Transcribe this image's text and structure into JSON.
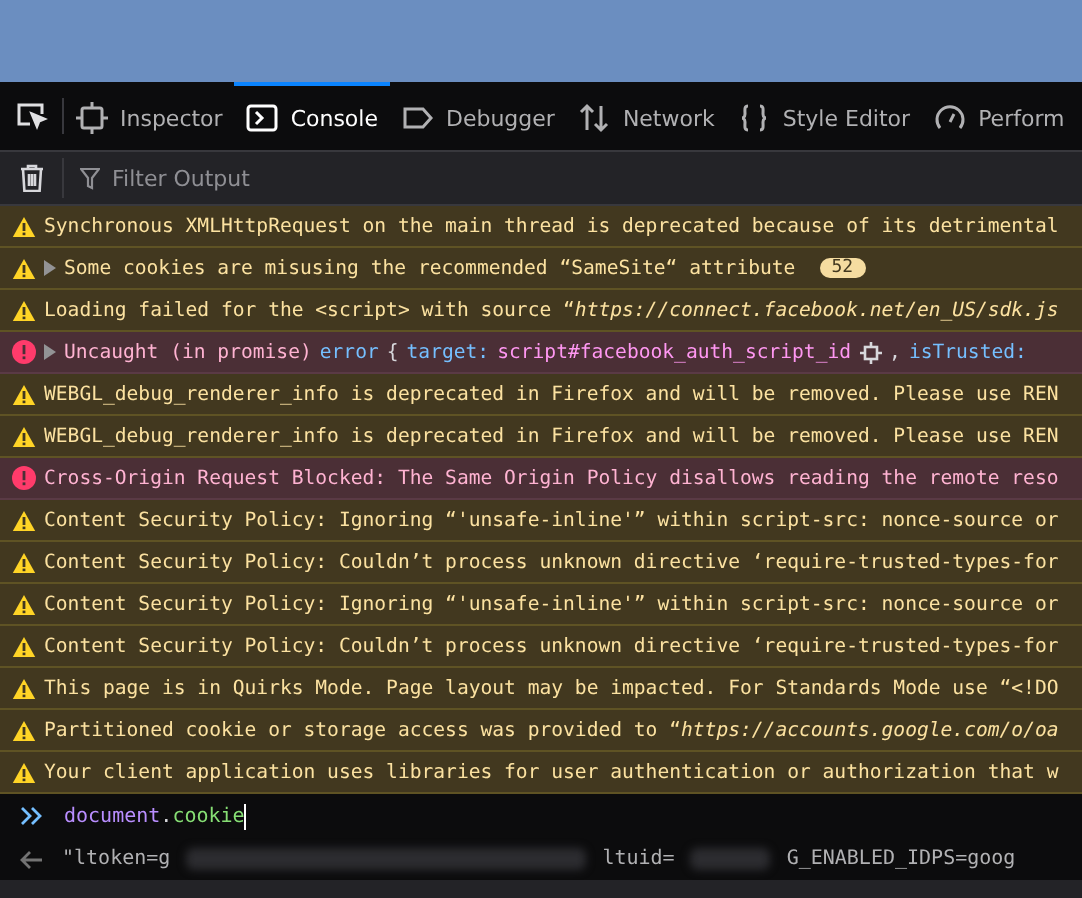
{
  "tabs": [
    {
      "label": "Inspector",
      "selected": false
    },
    {
      "label": "Console",
      "selected": true
    },
    {
      "label": "Debugger",
      "selected": false
    },
    {
      "label": "Network",
      "selected": false
    },
    {
      "label": "Style Editor",
      "selected": false
    },
    {
      "label": "Perform",
      "selected": false
    }
  ],
  "filter": {
    "placeholder": "Filter Output"
  },
  "messages": [
    {
      "kind": "warning",
      "expandable": false,
      "text": "Synchronous XMLHttpRequest on the main thread is deprecated because of its detrimental"
    },
    {
      "kind": "warning",
      "expandable": true,
      "text": "Some cookies are misusing the recommended “SameSite“ attribute",
      "badge": "52"
    },
    {
      "kind": "warning",
      "expandable": false,
      "text": "Loading failed for the <script> with source “*https://connect.facebook.net/en_US/sdk.js*"
    },
    {
      "kind": "error",
      "expandable": true,
      "text": "Uncaught (in promise)",
      "tokens": [
        {
          "kind": "keyword",
          "text": "error"
        },
        {
          "kind": "punct",
          "text": "{"
        },
        {
          "kind": "property",
          "text": "target:"
        },
        {
          "kind": "selector",
          "text": "script#facebook_auth_script_id"
        },
        {
          "kind": "node"
        },
        {
          "kind": "punct",
          "text": ","
        },
        {
          "kind": "property",
          "text": "isTrusted:"
        }
      ]
    },
    {
      "kind": "warning",
      "expandable": false,
      "text": "WEBGL_debug_renderer_info is deprecated in Firefox and will be removed. Please use REN"
    },
    {
      "kind": "warning",
      "expandable": false,
      "text": "WEBGL_debug_renderer_info is deprecated in Firefox and will be removed. Please use REN"
    },
    {
      "kind": "error",
      "expandable": false,
      "text": "Cross-Origin Request Blocked: The Same Origin Policy disallows reading the remote reso"
    },
    {
      "kind": "warning",
      "expandable": false,
      "text": "Content Security Policy: Ignoring “'unsafe-inline'” within script-src: nonce-source or"
    },
    {
      "kind": "warning",
      "expandable": false,
      "text": "Content Security Policy: Couldn’t process unknown directive ‘require-trusted-types-for"
    },
    {
      "kind": "warning",
      "expandable": false,
      "text": "Content Security Policy: Ignoring “'unsafe-inline'” within script-src: nonce-source or"
    },
    {
      "kind": "warning",
      "expandable": false,
      "text": "Content Security Policy: Couldn’t process unknown directive ‘require-trusted-types-for"
    },
    {
      "kind": "warning",
      "expandable": false,
      "text": "This page is in Quirks Mode. Page layout may be impacted. For Standards Mode use “<!DO"
    },
    {
      "kind": "warning",
      "expandable": false,
      "text": "Partitioned cookie or storage access was provided to “*https://accounts.google.com/o/oa*"
    },
    {
      "kind": "warning",
      "expandable": false,
      "text": "Your client application uses libraries for user authentication or authorization that w"
    }
  ],
  "input": {
    "object": "document",
    "dot": ".",
    "property": "cookie"
  },
  "result": [
    {
      "kind": "text",
      "text": "\"ltoken=g"
    },
    {
      "kind": "redacted"
    },
    {
      "kind": "text",
      "text": "ltuid="
    },
    {
      "kind": "redacted"
    },
    {
      "kind": "text",
      "text": "G_ENABLED_IDPS=goog"
    }
  ]
}
